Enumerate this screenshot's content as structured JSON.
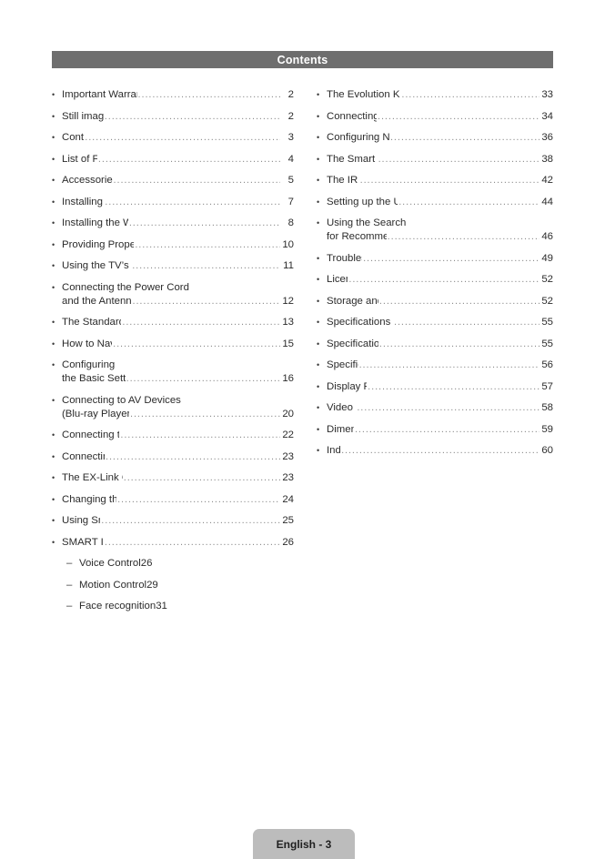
{
  "header": {
    "title": "Contents",
    "bar_color": "#6e6e6e",
    "title_color": "#ffffff"
  },
  "footer": {
    "label": "English - 3",
    "tab_color": "#bcbcbc"
  },
  "symbols": {
    "bullet": "•",
    "dash": "–"
  },
  "toc": {
    "left_column": [
      {
        "lines": [
          "Important Warranty Information Regarding"
        ],
        "page": "2"
      },
      {
        "lines": [
          "Still image warning"
        ],
        "page": "2"
      },
      {
        "lines": [
          "Contents"
        ],
        "page": "3"
      },
      {
        "lines": [
          "List of Features"
        ],
        "page": "4"
      },
      {
        "lines": [
          "Accessories and Cables"
        ],
        "page": "5"
      },
      {
        "lines": [
          "Installing the Stand"
        ],
        "page": "7"
      },
      {
        "lines": [
          "Installing the Wall Mount (Optional)"
        ],
        "page": "8"
      },
      {
        "lines": [
          "Providing Proper Ventilation for Your TV"
        ],
        "page": "10"
      },
      {
        "lines": [
          "Using the TV’s Controller (Panel Key)"
        ],
        "page": "11"
      },
      {
        "lines": [
          "Connecting the Power Cord",
          "and the Antenna or Cable Connection"
        ],
        "page": "12"
      },
      {
        "lines": [
          "The Standard Remote Control"
        ],
        "page": "13"
      },
      {
        "lines": [
          "How to Navigate Menus"
        ],
        "page": "15"
      },
      {
        "lines": [
          "Configuring",
          "the Basic Settings in Initial Setup"
        ],
        "page": "16"
      },
      {
        "lines": [
          "Connecting to AV Devices",
          "(Blu-ray Players, DVD Players, etc.)"
        ],
        "page": "20"
      },
      {
        "lines": [
          "Connecting to Audio Devices"
        ],
        "page": "22"
      },
      {
        "lines": [
          "Connecting to a PC"
        ],
        "page": "23"
      },
      {
        "lines": [
          "The EX-Link Cable Connection"
        ],
        "page": "23"
      },
      {
        "lines": [
          "Changing the Input Source"
        ],
        "page": "24"
      },
      {
        "lines": [
          "Using Smart Hub"
        ],
        "page": "25"
      },
      {
        "lines": [
          "SMART Interaction"
        ],
        "page": "26"
      }
    ],
    "left_column_sub": [
      {
        "label": "Voice Control",
        "page": "26"
      },
      {
        "label": "Motion Control",
        "page": "29"
      },
      {
        "label": "Face recognition",
        "page": "31"
      }
    ],
    "right_column": [
      {
        "lines": [
          "The Evolution Kit Slot (Kit Sold Separately)"
        ],
        "page": "33"
      },
      {
        "lines": [
          "Connecting to a Network"
        ],
        "page": "34"
      },
      {
        "lines": [
          "Configuring Network Connections"
        ],
        "page": "36"
      },
      {
        "lines": [
          "The Smart Touch Control"
        ],
        "page": "38"
      },
      {
        "lines": [
          "The IR Blaster"
        ],
        "page": "42"
      },
      {
        "lines": [
          "Setting up the Universal Remote Control"
        ],
        "page": "44"
      },
      {
        "lines": [
          "Using the Search",
          "for Recommended Model Code"
        ],
        "page": "46"
      },
      {
        "lines": [
          "Troubleshooting"
        ],
        "page": "49"
      },
      {
        "lines": [
          "Licenses"
        ],
        "page": "52"
      },
      {
        "lines": [
          "Storage and Maintenance"
        ],
        "page": "52"
      },
      {
        "lines": [
          "Specifications - Smart Touch Control"
        ],
        "page": "55"
      },
      {
        "lines": [
          "Specifications - IR Blaster"
        ],
        "page": "55"
      },
      {
        "lines": [
          "Specifications"
        ],
        "page": "56"
      },
      {
        "lines": [
          "Display Resolution"
        ],
        "page": "57"
      },
      {
        "lines": [
          "Video Codec"
        ],
        "page": "58"
      },
      {
        "lines": [
          "Dimensions"
        ],
        "page": "59"
      },
      {
        "lines": [
          "Index"
        ],
        "page": "60"
      }
    ]
  }
}
